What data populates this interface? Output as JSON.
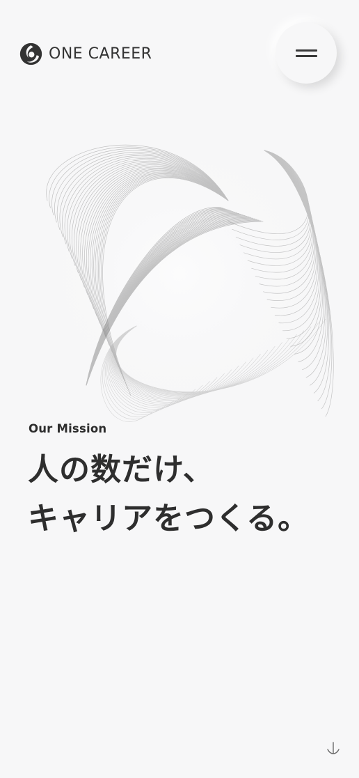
{
  "header": {
    "logo_text": "ONE CAREER",
    "menu_icon": "hamburger-icon"
  },
  "hero": {
    "graphic": "wireframe-sphere",
    "mission_label": "Our Mission",
    "headline_line1": "人の数だけ、",
    "headline_line2": "キャリアをつくる。"
  },
  "scroll_indicator": {
    "icon": "scroll-down-icon"
  },
  "colors": {
    "background": "#f7f7f8",
    "text": "#2e2e2e",
    "logo": "#333333"
  }
}
